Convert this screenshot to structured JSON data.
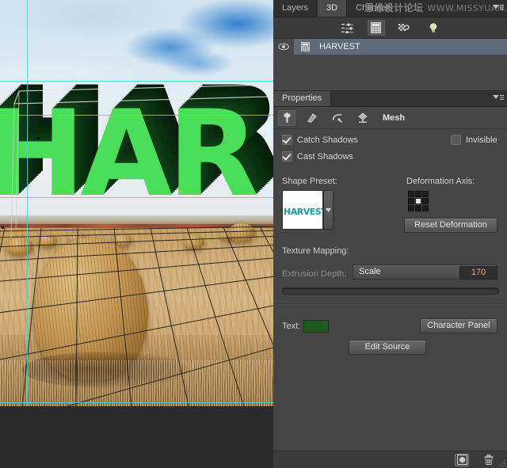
{
  "window": {
    "canvas_alt": "3D extruded green HARVEST text over hay bale field photograph"
  },
  "panel_tabs": {
    "items": [
      {
        "label": "Layers",
        "active": false
      },
      {
        "label": "3D",
        "active": true
      },
      {
        "label": "Channels",
        "active": false
      }
    ],
    "menu_icon": "panel-menu-icon"
  },
  "watermark": {
    "cn": "思缘设计论坛",
    "url": "WWW.MISSYUAN.COM"
  },
  "filter_bar": {
    "buttons": [
      {
        "name": "scene-filter-icon",
        "label": "Filter By: Entire Scene",
        "selected": false
      },
      {
        "name": "mesh-filter-icon",
        "label": "Filter By: Meshes",
        "selected": true
      },
      {
        "name": "materials-filter-icon",
        "label": "Filter By: Materials",
        "selected": false
      },
      {
        "name": "lights-filter-icon",
        "label": "Filter By: Lights",
        "selected": false
      }
    ]
  },
  "scene_list": {
    "rows": [
      {
        "name": "HARVEST",
        "visible": true,
        "selected": true
      }
    ]
  },
  "properties": {
    "tab_label": "Properties",
    "menu_icon": "panel-menu-icon",
    "tool_buttons": [
      {
        "name": "mesh-tool-icon",
        "selected": true
      },
      {
        "name": "deform-tool-icon",
        "selected": false
      },
      {
        "name": "cap-tool-icon",
        "selected": false
      },
      {
        "name": "coordinates-tool-icon",
        "selected": false
      }
    ],
    "section_title": "Mesh",
    "checkboxes": [
      {
        "label": "Catch Shadows",
        "checked": true
      },
      {
        "label": "Cast Shadows",
        "checked": true
      },
      {
        "label": "Invisible",
        "checked": false
      }
    ],
    "shape_preset": {
      "label": "Shape Preset:",
      "thumbnail_text": "HARVEST",
      "thumbnail_color": "#1f9c9c"
    },
    "deformation": {
      "label": "Deformation Axis:",
      "selected_cell": 4,
      "reset_button": "Reset Deformation"
    },
    "texture_mapping": {
      "label": "Texture Mapping:",
      "value": "Scale"
    },
    "extrusion_depth": {
      "label": "Extrusion Depth:",
      "value": "170"
    },
    "text": {
      "label": "Text:",
      "color": "#1d5a1d",
      "character_panel_button": "Character Panel",
      "edit_source_button": "Edit Source"
    }
  },
  "status_bar": {
    "buttons": [
      {
        "name": "new-mesh-icon",
        "selected": true
      },
      {
        "name": "delete-icon",
        "selected": false
      }
    ]
  },
  "canvas": {
    "text_3d": "HAR",
    "face_color": "#4ade5a",
    "extrude_color": "#0e3d16",
    "guide_color": "#3fd6d6"
  }
}
